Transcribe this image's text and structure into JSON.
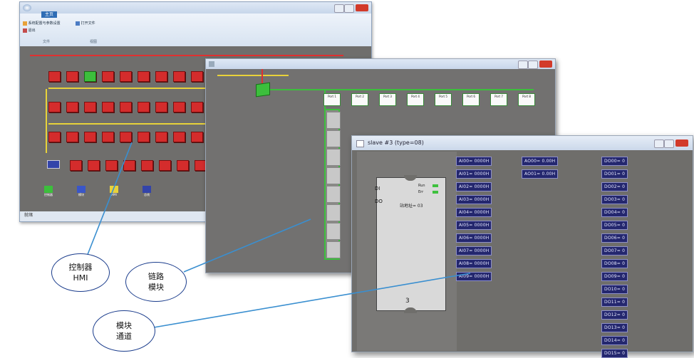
{
  "window1": {
    "tab_label": "主页",
    "ribbon_buttons": [
      "系统配置与参数设置",
      "打开文件",
      "退出"
    ],
    "group_labels": [
      "文件",
      "视图"
    ],
    "status": "就绪",
    "legend_items": [
      "控制器",
      "模块",
      "HMI",
      "总线"
    ]
  },
  "window2": {
    "ports": [
      "Port 1",
      "Port 2",
      "Port 3",
      "Port 4",
      "Port 5",
      "Port 6",
      "Port 7",
      "Port 8"
    ]
  },
  "window3": {
    "title": "slave #3 (type=08)",
    "device": {
      "di": "DI",
      "do": "DO",
      "run_label": "Run",
      "err_label": "Err",
      "addr_label": "站地址= 03",
      "slot": "3"
    },
    "ai_channels": [
      "AI00= 0000H",
      "AI01= 0000H",
      "AI02= 0000H",
      "AI03= 0000H",
      "AI04= 0000H",
      "AI05= 0000H",
      "AI06= 0000H",
      "AI07= 0000H",
      "AI08= 0000H",
      "AI09= 0000H"
    ],
    "ao_channels": [
      "AO00= 0.00H",
      "AO01= 0.00H"
    ],
    "do_channels": [
      "DO00= 0",
      "DO01= 0",
      "DO02= 0",
      "DO03= 0",
      "DO04= 0",
      "DO05= 0",
      "DO06= 0",
      "DO07= 0",
      "DO08= 0",
      "DO09= 0",
      "DO10= 0",
      "DO11= 0",
      "DO12= 0",
      "DO13= 0",
      "DO14= 0",
      "DO15= 0"
    ]
  },
  "callouts": {
    "controller": [
      "控制器",
      "HMI"
    ],
    "link": [
      "链路",
      "模块"
    ],
    "channel": [
      "模块",
      "通道"
    ]
  },
  "colors": {
    "node_red": "#d42c2c",
    "chip_blue": "#24276e",
    "canvas_grey": "#6f6e6c",
    "line_green": "#3cbf3c",
    "callout_line": "#3a8fd0"
  }
}
